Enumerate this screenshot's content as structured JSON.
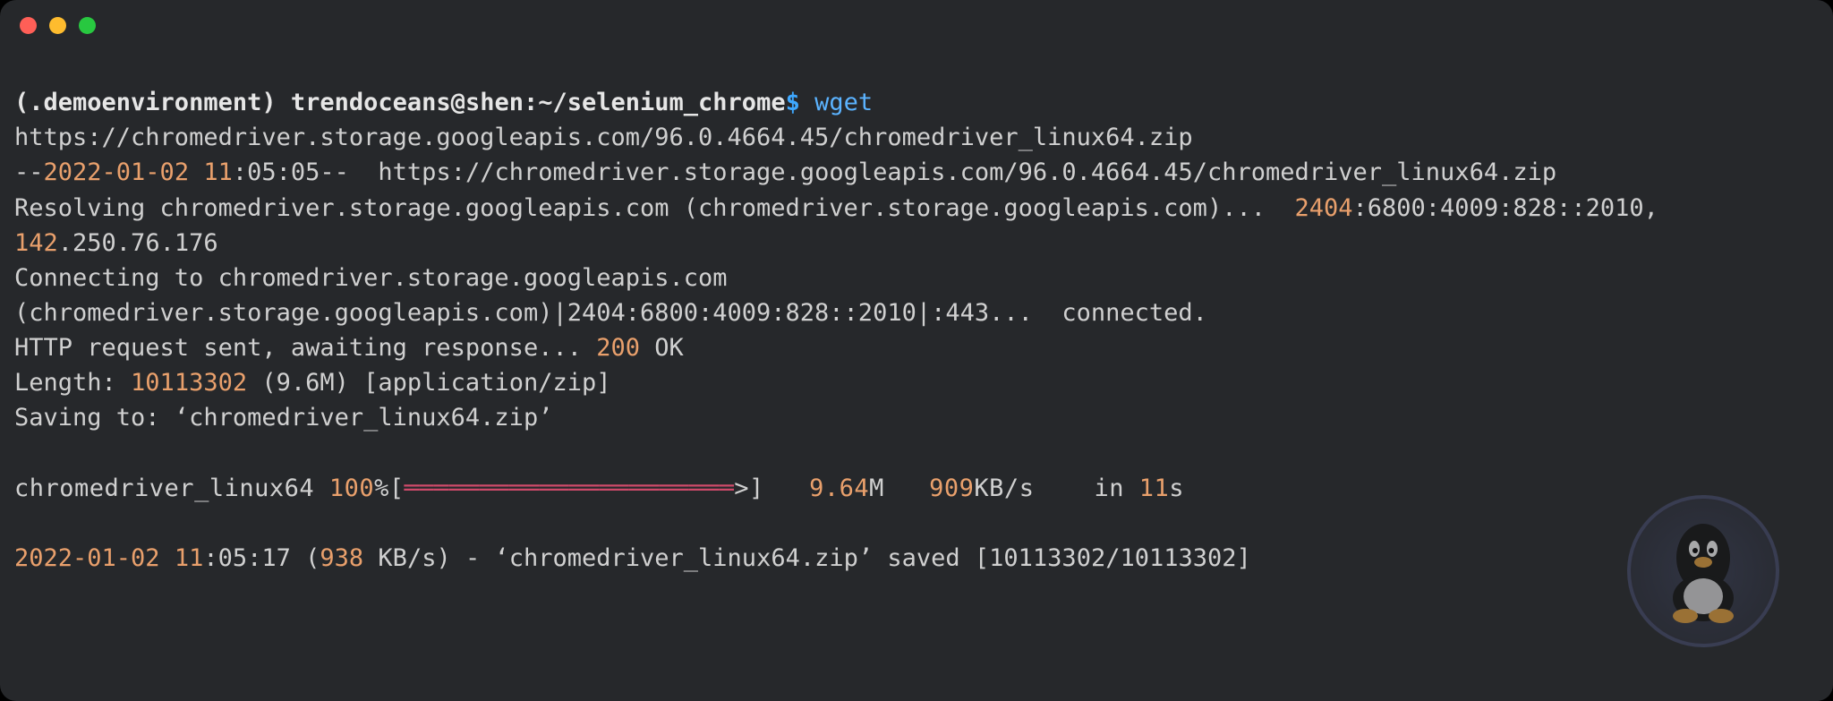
{
  "prompt": {
    "env": "(.demoenvironment)",
    "userhost": "trendoceans@shen",
    "path": "~/selenium_chrome",
    "dollar": "$",
    "command": "wget"
  },
  "lines": {
    "url": "https://chromedriver.storage.googleapis.com/96.0.4664.45/chromedriver_linux64.zip",
    "ts_pre": "--",
    "ts_date": "2022-01-02",
    "ts_time_h": "11",
    "ts_time_rest": ":05:05--",
    "ts_url_label": "  https://chromedriver.storage.googleapis.com/96.0.4664.45/chromedriver_linux64.zip",
    "resolve_a": "Resolving chromedriver.storage.googleapis.com (chromedriver.storage.googleapis.com)...  ",
    "resolve_ip6": "2404",
    "resolve_ip6_rest": ":6800:4009:828::2010,",
    "resolve_ip4_a": "142",
    "resolve_ip4_rest": ".250.76.176",
    "connect_a": "Connecting to chromedriver.storage.googleapis.com",
    "connect_b": "(chromedriver.storage.googleapis.com)|2404:6800:4009:828::2010|:443...  connected.",
    "http_a": "HTTP request sent, awaiting response... ",
    "http_code": "200",
    "http_ok": " OK",
    "length_a": "Length: ",
    "length_n": "10113302",
    "length_b": " (9.6M) [application/zip]",
    "saving": "Saving to: ‘chromedriver_linux64.zip’",
    "prog_name": "chromedriver_linux64 ",
    "prog_pct": "100",
    "prog_open": "%[",
    "prog_fill": "══════════════════════",
    "prog_close": ">]   ",
    "prog_size": "9.64",
    "prog_size_u": "M   ",
    "prog_rate": "909",
    "prog_rate_u": "KB/s    in ",
    "prog_eta": "11",
    "prog_eta_u": "s",
    "done_date": "2022-01-02",
    "done_sp": " ",
    "done_h": "11",
    "done_rest": ":05:17 (",
    "done_rate": "938",
    "done_rate_u": " KB/s) - ‘chromedriver_linux64.zip’ saved [",
    "done_bytes": "10113302/10113302",
    "done_close": "]"
  }
}
